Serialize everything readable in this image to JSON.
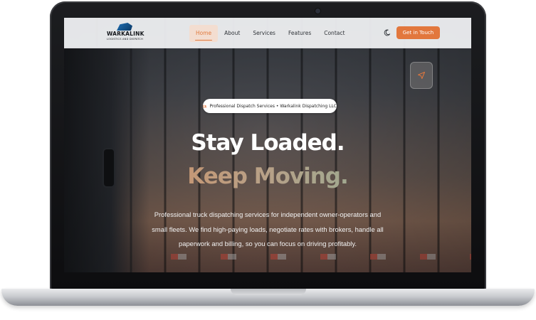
{
  "brand": {
    "name": "WARKALINK",
    "tagline": "LOGISTICS AND DISPATCH"
  },
  "nav": {
    "items": [
      {
        "label": "Home",
        "active": true
      },
      {
        "label": "About",
        "active": false
      },
      {
        "label": "Services",
        "active": false
      },
      {
        "label": "Features",
        "active": false
      },
      {
        "label": "Contact",
        "active": false
      }
    ],
    "theme_toggle_icon": "moon-icon",
    "cta_label": "Get in Touch"
  },
  "hero": {
    "badge_icon": "truck-icon",
    "badge": "Professional Dispatch Services • Warkalink Dispatching LLC",
    "headline_1": "Stay Loaded.",
    "headline_2": "Keep Moving.",
    "description": "Professional truck dispatching services for independent owner-operators and small fleets. We find high-paying loads, negotiate rates with brokers, handle all paperwork and billing, so you can focus on driving profitably.",
    "fab_icon": "send-icon"
  },
  "colors": {
    "accent": "#e2773d",
    "accent_soft": "#f3ddd0",
    "headline_gradient_start": "#d88a5a",
    "headline_gradient_end": "#7fb39a"
  }
}
